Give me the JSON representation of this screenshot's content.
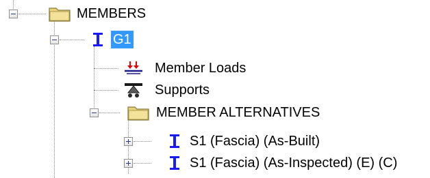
{
  "tree": {
    "root": {
      "label": "MEMBERS",
      "icon": "folder-icon",
      "expanded": true
    },
    "member": {
      "label": "G1",
      "icon": "i-beam-icon",
      "expanded": true,
      "selected": true
    },
    "member_children": [
      {
        "label": "Member Loads",
        "icon": "member-loads-icon"
      },
      {
        "label": "Supports",
        "icon": "supports-icon"
      }
    ],
    "alternatives": {
      "label": "MEMBER ALTERNATIVES",
      "icon": "folder-icon",
      "expanded": true,
      "items": [
        {
          "label": "S1 (Fascia) (As-Built)",
          "icon": "i-beam-icon",
          "expanded": false
        },
        {
          "label": "S1 (Fascia) (As-Inspected) (E) (C)",
          "icon": "i-beam-icon",
          "expanded": false
        }
      ]
    }
  },
  "colors": {
    "selection": "#3399ff",
    "beam_icon": "#1a1aff",
    "load_arrows": "#e00000",
    "folder": "#e8d27a"
  }
}
